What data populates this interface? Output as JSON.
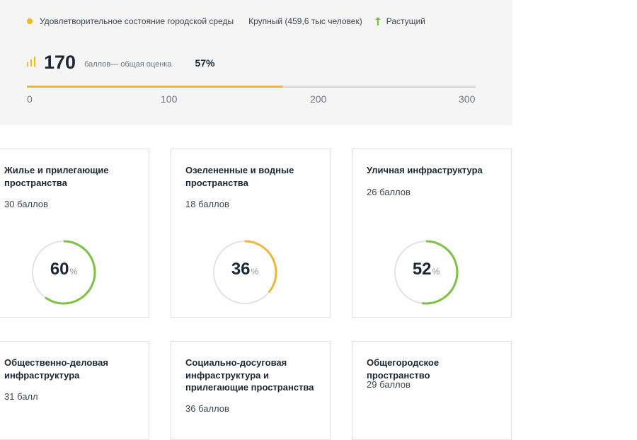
{
  "summary": {
    "condition": "Удовлетворительное состояние городской среды",
    "size": "Крупный (459,6 тыс человек)",
    "trend": "Растущий",
    "score": "170",
    "score_label": "баллов— общая оценка",
    "percent": "57%",
    "progress_fraction": 0.57,
    "scale_ticks": [
      "0",
      "100",
      "200",
      "300"
    ]
  },
  "colors": {
    "accent": "#f2b918",
    "green": "#7cc242",
    "orange": "#f2b43c",
    "track": "#e3e3e3"
  },
  "icons": {
    "status_dot": "yellow-dot-icon",
    "trend": "arrow-up-icon",
    "score": "bar-chart-icon"
  },
  "cards": [
    {
      "title": "Жилье и прилегающие пространства",
      "score": "30 баллов",
      "percent": "60",
      "unit": "%",
      "fraction": 0.6,
      "color": "#7cc242"
    },
    {
      "title": "Озелененные и водные пространства",
      "score": "18 баллов",
      "percent": "36",
      "unit": "%",
      "fraction": 0.36,
      "color": "#f2b43c"
    },
    {
      "title": "Уличная инфраструктура",
      "score": "26 баллов",
      "percent": "52",
      "unit": "%",
      "fraction": 0.52,
      "color": "#7cc242"
    },
    {
      "title": "Общественно-деловая инфраструктура",
      "score": "31 балл",
      "percent": null,
      "unit": null,
      "fraction": null,
      "color": null
    },
    {
      "title": "Социально-досуговая инфраструктура и прилегающие пространства",
      "score": "36 баллов",
      "percent": null,
      "unit": null,
      "fraction": null,
      "color": null
    },
    {
      "title": "Общегородское пространство",
      "score": "29 баллов",
      "percent": null,
      "unit": null,
      "fraction": null,
      "color": null
    }
  ]
}
